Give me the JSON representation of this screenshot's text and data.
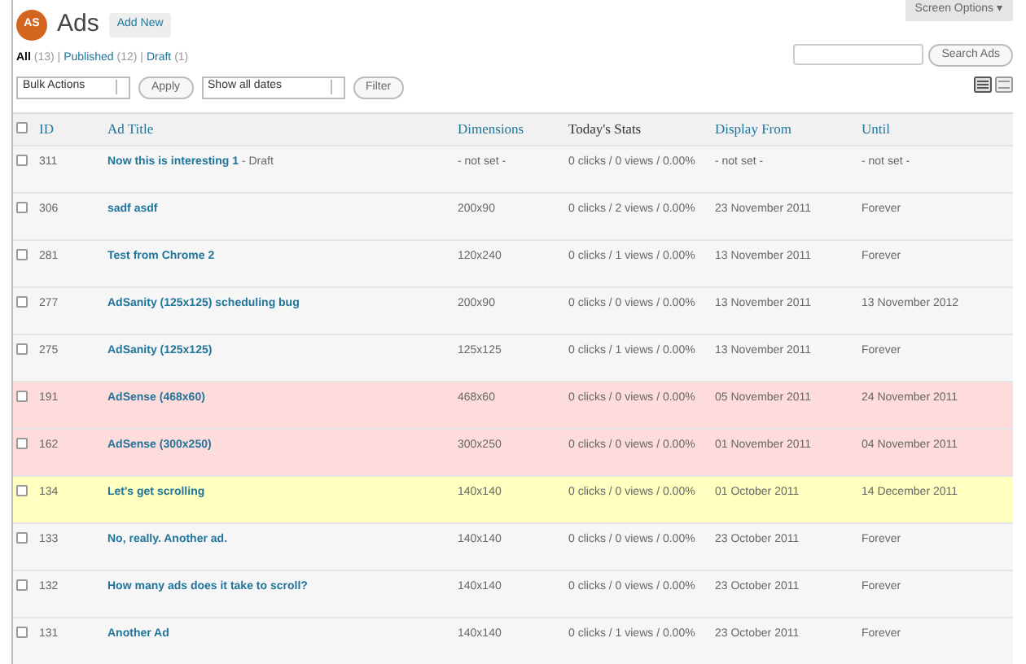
{
  "header": {
    "logo": "AS",
    "title": "Ads",
    "add_new": "Add New",
    "screen_options": {
      "label": "Screen Options",
      "arrow": "▾"
    }
  },
  "views": {
    "separator": "|",
    "items": [
      {
        "label": "All",
        "count": "(13)",
        "selected": true
      },
      {
        "label": "Published",
        "count": "(12)",
        "selected": false
      },
      {
        "label": "Draft",
        "count": "(1)",
        "selected": false
      }
    ]
  },
  "search": {
    "button": "Search Ads"
  },
  "toolbar": {
    "bulk_select": "Bulk Actions",
    "apply": "Apply",
    "date_select": "Show all dates",
    "filter": "Filter"
  },
  "view_modes": [
    {
      "kind": "list",
      "selected": true
    },
    {
      "kind": "excerpt",
      "selected": false
    }
  ],
  "table": {
    "select_all": {
      "checked": false
    },
    "columns": [
      {
        "label": "ID",
        "sortable": true
      },
      {
        "label": "Ad Title",
        "sortable": true
      },
      {
        "label": "Dimensions",
        "sortable": true
      },
      {
        "label": "Today's Stats",
        "sortable": false
      },
      {
        "label": "Display From",
        "sortable": true
      },
      {
        "label": "Until",
        "sortable": true
      }
    ],
    "rows": [
      {
        "color": "#f6f6f6",
        "checked": false,
        "id": "311",
        "title": "Now this is interesting 1",
        "note": "- Draft",
        "dimensions": "- not set -",
        "stats": "0 clicks / 0 views / 0.00%",
        "from": "- not set -",
        "until": "- not set -"
      },
      {
        "color": "#f6f6f6",
        "checked": false,
        "id": "306",
        "title": "sadf asdf",
        "dimensions": "200x90",
        "stats": "0 clicks / 2 views / 0.00%",
        "from": "23 November 2011",
        "until": "Forever"
      },
      {
        "color": "#f6f6f6",
        "checked": false,
        "id": "281",
        "title": "Test from Chrome 2",
        "dimensions": "120x240",
        "stats": "0 clicks / 1 views / 0.00%",
        "from": "13 November 2011",
        "until": "Forever"
      },
      {
        "color": "#f6f6f6",
        "checked": false,
        "id": "277",
        "title": "AdSanity (125x125) scheduling bug",
        "dimensions": "200x90",
        "stats": "0 clicks / 0 views / 0.00%",
        "from": "13 November 2011",
        "until": "13 November 2012"
      },
      {
        "color": "#f6f6f6",
        "checked": false,
        "id": "275",
        "title": "AdSanity (125x125)",
        "dimensions": "125x125",
        "stats": "0 clicks / 1 views / 0.00%",
        "from": "13 November 2011",
        "until": "Forever"
      },
      {
        "color": "#ffdcdc",
        "checked": false,
        "id": "191",
        "title": "AdSense (468x60)",
        "dimensions": "468x60",
        "stats": "0 clicks / 0 views / 0.00%",
        "from": "05 November 2011",
        "until": "24 November 2011"
      },
      {
        "color": "#ffdcdc",
        "checked": false,
        "id": "162",
        "title": "AdSense (300x250)",
        "dimensions": "300x250",
        "stats": "0 clicks / 0 views / 0.00%",
        "from": "01 November 2011",
        "until": "04 November 2011"
      },
      {
        "color": "#ffffbf",
        "checked": false,
        "id": "134",
        "title": "Let's get scrolling",
        "dimensions": "140x140",
        "stats": "0 clicks / 0 views / 0.00%",
        "from": "01 October 2011",
        "until": "14 December 2011"
      },
      {
        "color": "#f6f6f6",
        "checked": false,
        "id": "133",
        "title": "No, really. Another ad.",
        "dimensions": "140x140",
        "stats": "0 clicks / 0 views / 0.00%",
        "from": "23 October 2011",
        "until": "Forever"
      },
      {
        "color": "#f6f6f6",
        "checked": false,
        "id": "132",
        "title": "How many ads does it take to scroll?",
        "dimensions": "140x140",
        "stats": "0 clicks / 0 views / 0.00%",
        "from": "23 October 2011",
        "until": "Forever"
      },
      {
        "color": "#f6f6f6",
        "checked": false,
        "id": "131",
        "title": "Another Ad",
        "dimensions": "140x140",
        "stats": "0 clicks / 1 views / 0.00%",
        "from": "23 October 2011",
        "until": "Forever"
      }
    ]
  }
}
